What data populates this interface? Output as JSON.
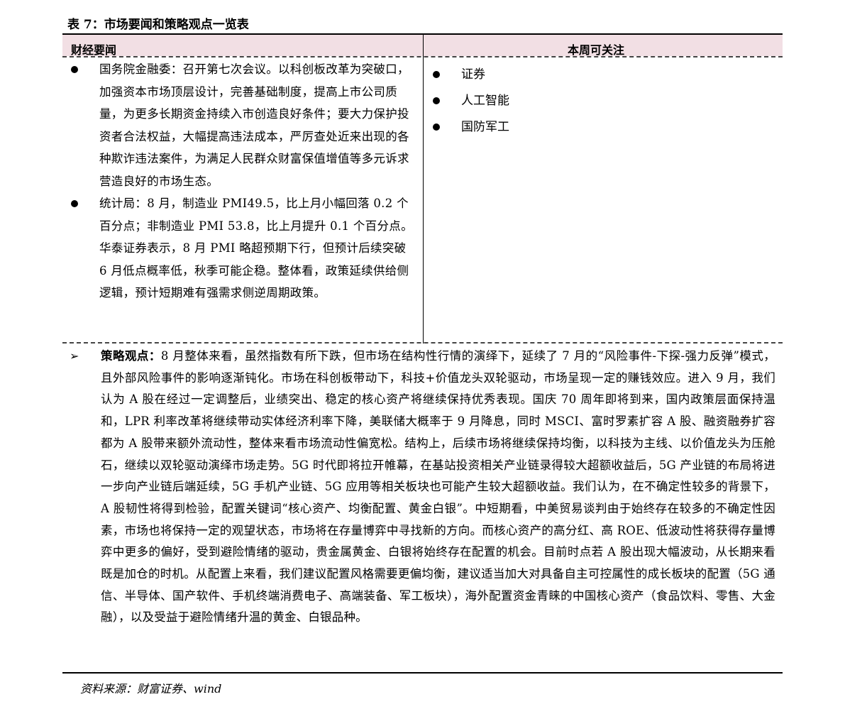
{
  "title": "表 7：市场要闻和策略观点一览表",
  "table": {
    "header_left": "财经要闻",
    "header_right": "本周可关注",
    "news": [
      "国务院金融委：召开第七次会议。以科创板改革为突破口，加强资本市场顶层设计，完善基础制度，提高上市公司质量，为更多长期资金持续入市创造良好条件；要大力保护投资者合法权益，大幅提高违法成本，严厉查处近来出现的各种欺诈违法案件，为满足人民群众财富保值增值等多元诉求营造良好的市场生态。",
      "统计局：8 月，制造业 PMI49.5，比上月小幅回落 0.2 个百分点；非制造业 PMI 53.8，比上月提升 0.1 个百分点。华泰证券表示，8 月 PMI 略超预期下行，但预计后续突破 6 月低点概率低，秋季可能企稳。整体看，政策延续供给侧逻辑，预计短期难有强需求侧逆周期政策。"
    ],
    "focus": [
      "证券",
      "人工智能",
      "国防军工"
    ],
    "strategy_label": "策略观点：",
    "strategy_text": "8 月整体来看，虽然指数有所下跌，但市场在结构性行情的演绎下，延续了 7 月的“风险事件-下探-强力反弹”模式，且外部风险事件的影响逐渐钝化。市场在科创板带动下，科技+价值龙头双轮驱动，市场呈现一定的赚钱效应。进入 9 月，我们认为 A 股在经过一定调整后，业绩突出、稳定的核心资产将继续保持优秀表现。国庆 70 周年即将到来，国内政策层面保持温和，LPR 利率改革将继续带动实体经济利率下降，美联储大概率于 9 月降息，同时 MSCI、富时罗素扩容 A 股、融资融券扩容都为 A 股带来额外流动性，整体来看市场流动性偏宽松。结构上，后续市场将继续保持均衡，以科技为主线、以价值龙头为压舱石，继续以双轮驱动演绎市场走势。5G 时代即将拉开帷幕，在基站投资相关产业链录得较大超额收益后，5G 产业链的布局将进一步向产业链后端延续，5G 手机产业链、5G 应用等相关板块也可能产生较大超额收益。我们认为，在不确定性较多的背景下，A 股韧性将得到检验，配置关键词“核心资产、均衡配置、黄金白银”。中短期看，中美贸易谈判由于始终存在较多的不确定性因素，市场也将保持一定的观望状态，市场将在存量博弈中寻找新的方向。而核心资产的高分红、高 ROE、低波动性将获得存量博弈中更多的偏好，受到避险情绪的驱动，贵金属黄金、白银将始终存在配置的机会。目前时点若 A 股出现大幅波动，从长期来看既是加仓的时机。从配置上来看，我们建议配置风格需要更偏均衡，建议适当加大对具备自主可控属性的成长板块的配置（5G 通信、半导体、国产软件、手机终端消费电子、高端装备、军工板块），海外配置资金青睐的中国核心资产（食品饮料、零售、大金融），以及受益于避险情绪升温的黄金、白银品种。"
  },
  "source": "资料来源：财富证券、wind"
}
